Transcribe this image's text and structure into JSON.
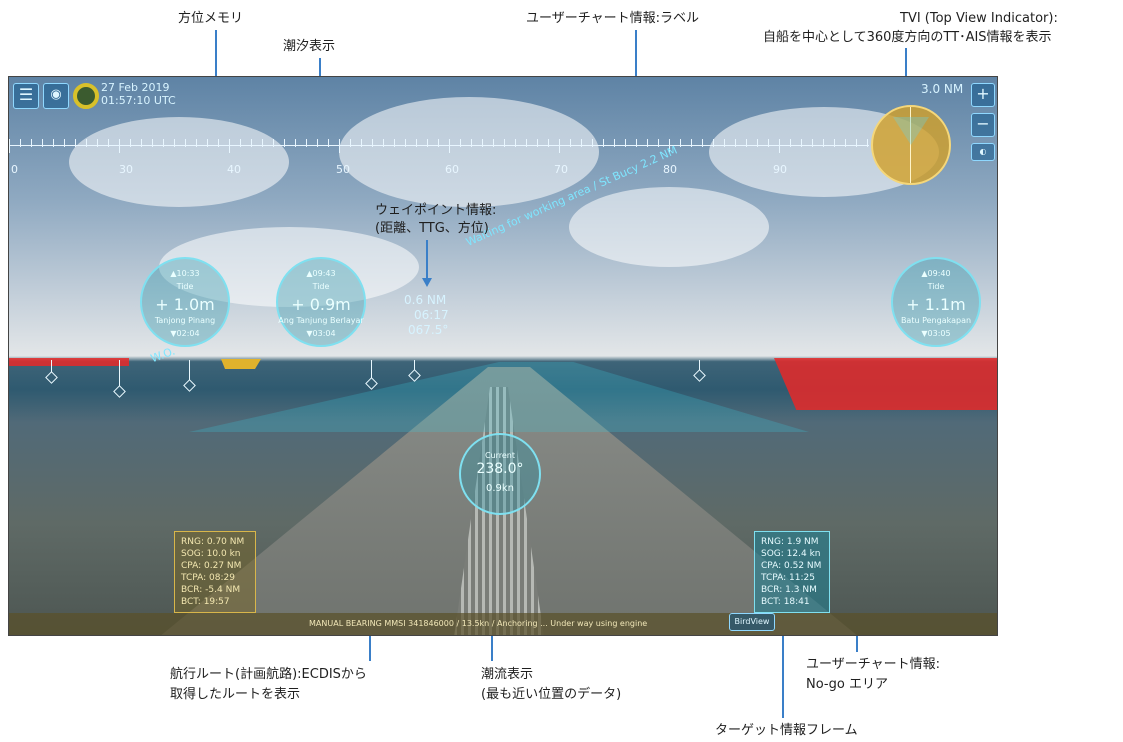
{
  "annotations": {
    "bearing_memory": "方位メモリ",
    "tide_display": "潮汐表示",
    "user_chart_label": "ユーザーチャート情報:ラベル",
    "tvi_title": "TVI (Top View Indicator):",
    "tvi_desc": "自船を中心として360度方向のTT･AIS情報を表示",
    "waypoint_info_1": "ウェイポイント情報:",
    "waypoint_info_2": "(距離、TTG、方位)",
    "route_1": "航行ルート(計画航路):ECDISから",
    "route_2": "取得したルートを表示",
    "current_1": "潮流表示",
    "current_2": "(最も近い位置のデータ)",
    "nogo_1": "ユーザーチャート情報:",
    "nogo_2": "No-go エリア",
    "target_frame": "ターゲット情報フレーム"
  },
  "hud": {
    "date": "27 Feb 2019",
    "time": "01:57:10 UTC",
    "range": "3.0 NM",
    "compass_labels": [
      "0",
      "30",
      "40",
      "50",
      "60",
      "70",
      "80",
      "90"
    ],
    "chart_label": "Waiting for working area / St Bucy 2.2 NM",
    "route_label": "W.O.",
    "waypoint": {
      "distance": "0.6 NM",
      "ttg": "06:17",
      "bearing": "067.5°"
    },
    "tide_left": {
      "top": "▲10:33",
      "title": "Tide",
      "value": "+ 1.0m",
      "place": "Tanjong Pinang",
      "bottom": "▼02:04"
    },
    "tide_mid": {
      "top": "▲09:43",
      "title": "Tide",
      "value": "+ 0.9m",
      "place": "Ang Tanjung Berlayar",
      "bottom": "▼03:04"
    },
    "tide_right": {
      "top": "▲09:40",
      "title": "Tide",
      "value": "+ 1.1m",
      "place": "Batu Pengakapan",
      "bottom": "▼03:05"
    },
    "current": {
      "title": "Current",
      "direction": "238.0°",
      "speed": "0.9kn"
    },
    "target_left": [
      "RNG: 0.70 NM",
      "SOG: 10.0 kn",
      "CPA: 0.27 NM",
      "TCPA: 08:29",
      "BCR: -5.4 NM",
      "BCT: 19:57"
    ],
    "target_right": [
      "RNG: 1.9 NM",
      "SOG: 12.4 kn",
      "CPA: 0.52 NM",
      "TCPA: 11:25",
      "BCR: 1.3 NM",
      "BCT: 18:41"
    ],
    "bottom_message": "MANUAL BEARING  MMSI 341846000 / 13.5kn / Anchoring  ...  Under way using engine",
    "birdview_button": "BirdView",
    "plus": "+",
    "minus": "−",
    "menu_icon": "menu-icon",
    "camera_icon": "camera-icon"
  }
}
